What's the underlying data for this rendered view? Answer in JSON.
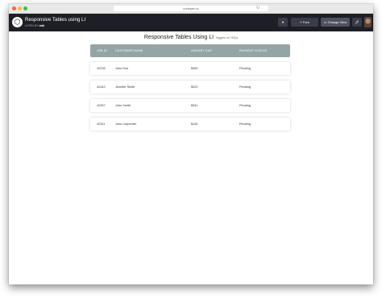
{
  "browser": {
    "url": "codepen.io"
  },
  "header": {
    "pen_title": "Responsive Tables using LI",
    "pen_by_prefix": "A PEN BY",
    "pen_by_author": "rabi",
    "fork_label": "Fork",
    "change_view_label": "Change View"
  },
  "page": {
    "title": "Responsive Tables Using LI",
    "subtitle": "Triggers on 767px"
  },
  "table": {
    "headers": [
      "JOB ID",
      "CUSTOMER NAME",
      "AMOUNT DUE",
      "PAYMENT STATUS"
    ],
    "rows": [
      [
        "42235",
        "John Doe",
        "$350",
        "Pending"
      ],
      [
        "42442",
        "Jennifer Smith",
        "$220",
        "Pending"
      ],
      [
        "42257",
        "John Smith",
        "$341",
        "Pending"
      ],
      [
        "42311",
        "John Carpenter",
        "$115",
        "Pending"
      ]
    ]
  }
}
